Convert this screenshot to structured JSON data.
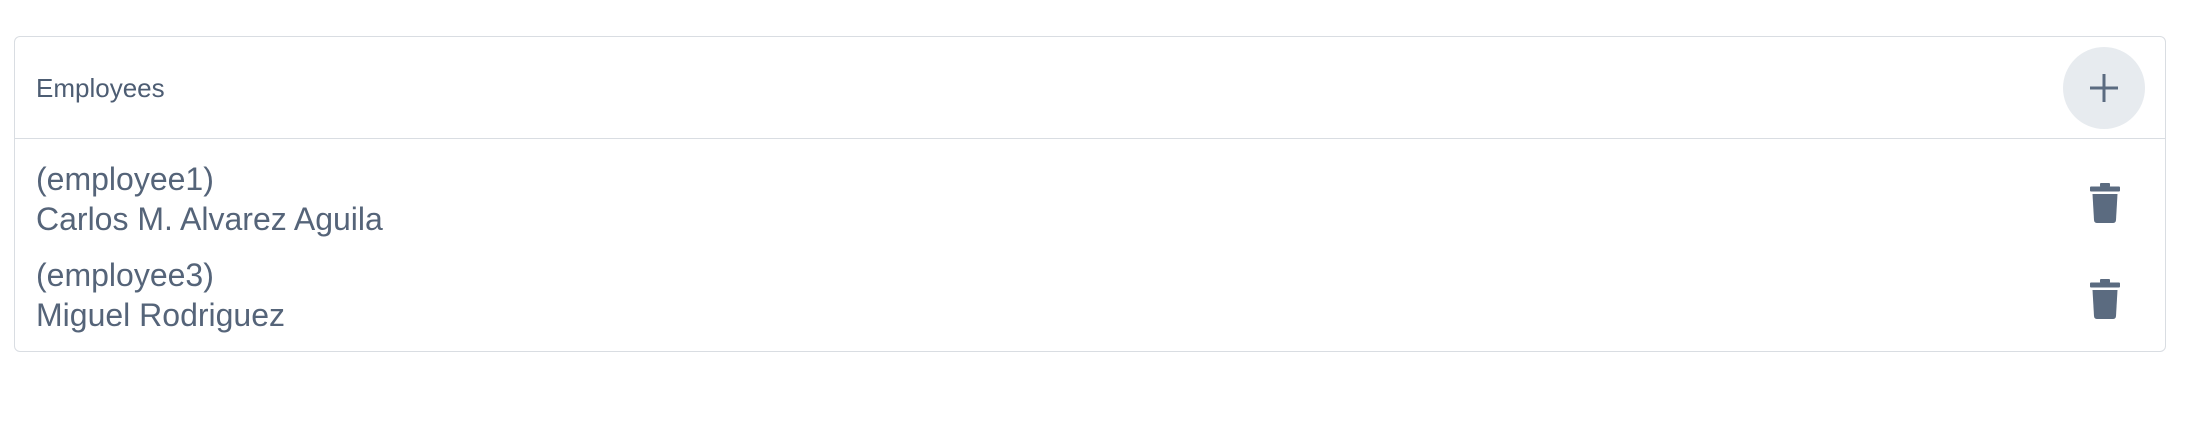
{
  "panel": {
    "title": "Employees",
    "add_icon": "plus-icon",
    "delete_icon": "trash-icon"
  },
  "employees": [
    {
      "id": "(employee1)",
      "name": "Carlos M. Alvarez Aguila"
    },
    {
      "id": "(employee3)",
      "name": "Miguel Rodriguez"
    }
  ],
  "colors": {
    "text": "#53627a",
    "icon": "#5b6b80",
    "add_button_bg": "#e7ebef",
    "border": "#d9dde2"
  }
}
